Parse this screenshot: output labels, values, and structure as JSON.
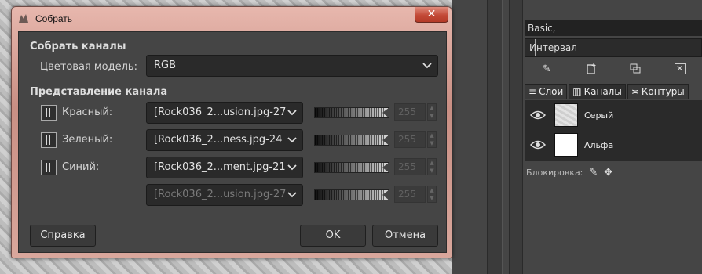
{
  "dialog": {
    "title": "Собрать",
    "close_label": "✕",
    "compose_section": "Собрать каналы",
    "color_model_label": "Цветовая модель:",
    "color_model_value": "RGB",
    "channel_section": "Представление канала",
    "channels": [
      {
        "label": "Красный:",
        "source": "[Rock036_2...usion.jpg-27",
        "value": "255"
      },
      {
        "label": "Зеленый:",
        "source": "[Rock036_2...ness.jpg-24",
        "value": "255"
      },
      {
        "label": "Синий:",
        "source": "[Rock036_2...ment.jpg-21",
        "value": "255"
      },
      {
        "label": "",
        "source": "[Rock036_2...usion.jpg-27",
        "value": "255"
      }
    ],
    "help_button": "Справка",
    "ok_button": "OK",
    "cancel_button": "Отмена"
  },
  "dock": {
    "brush_name": "Basic,",
    "spacing_label": "Интервал",
    "tabs": [
      "Слои",
      "Каналы",
      "Контуры"
    ],
    "channel_items": [
      {
        "name": "Серый"
      },
      {
        "name": "Альфа"
      }
    ],
    "lock_label": "Блокировка:"
  },
  "colors": {
    "titlebar": "#d9a79c",
    "close": "#c34a37",
    "panel": "#454545",
    "field": "#2a2a2a"
  }
}
